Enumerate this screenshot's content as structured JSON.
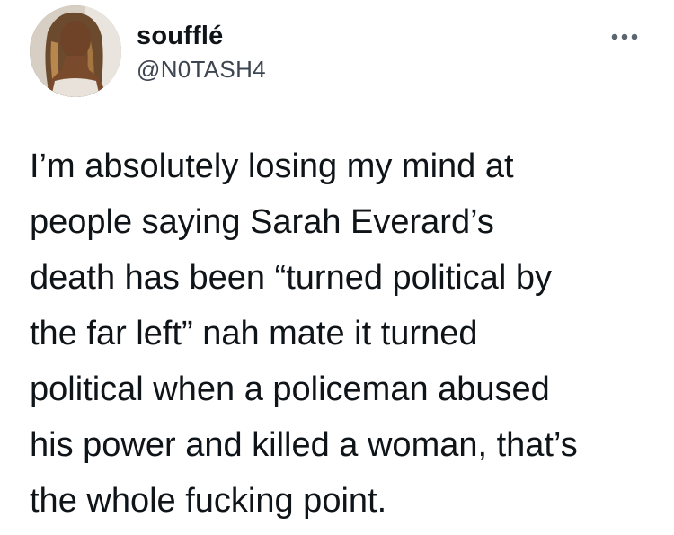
{
  "tweet": {
    "display_name": "soufflé",
    "handle": "@N0TASH4",
    "text": "I’m absolutely losing my mind at\npeople saying Sarah Everard’s\ndeath has been “turned political by\nthe far left” nah mate it turned\npolitical when a policeman abused\nhis power and killed a woman, that’s\nthe whole fucking point.",
    "avatar_icon": "profile-photo",
    "more_icon": "more-horizontal-icon"
  },
  "colors": {
    "text": "#0f1419",
    "secondary": "#3d4650",
    "icon": "#5b6670"
  }
}
